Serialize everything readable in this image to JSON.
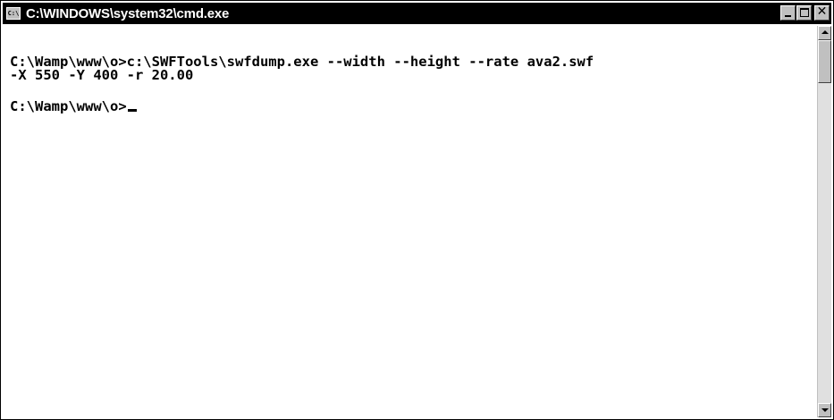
{
  "window": {
    "title": "C:\\WINDOWS\\system32\\cmd.exe",
    "icon": "cmd-icon",
    "icon_text": "C:\\",
    "close_glyph": "✕"
  },
  "console": {
    "lines": [
      "C:\\Wamp\\www\\o>c:\\SWFTools\\swfdump.exe --width --height --rate ava2.swf",
      "-X 550 -Y 400 -r 20.00",
      "",
      "C:\\Wamp\\www\\o>"
    ],
    "cursor": "underscore-cursor"
  },
  "colors": {
    "titlebar": "#000000",
    "title_text": "#ffffff",
    "console_bg": "#ffffff",
    "console_text": "#000000",
    "chrome": "#c0c0c0"
  }
}
